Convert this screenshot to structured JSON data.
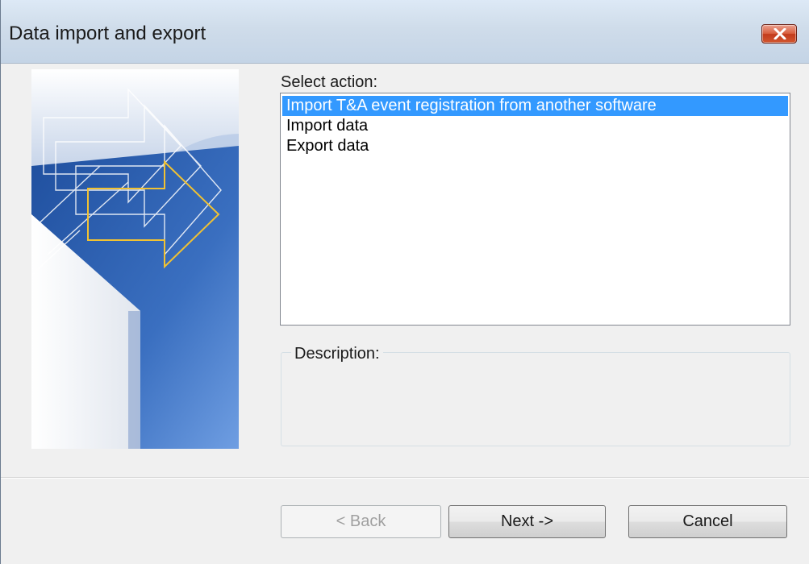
{
  "window": {
    "title": "Data import and export",
    "close_icon": "close-x-icon"
  },
  "action_select": {
    "label": "Select action:",
    "items": [
      "Import T&A event registration from another software",
      "Import data",
      "Export data"
    ],
    "selected_index": 0
  },
  "description": {
    "label": "Description:",
    "text": ""
  },
  "buttons": {
    "back": "< Back",
    "next": "Next ->",
    "cancel": "Cancel"
  },
  "colors": {
    "selection": "#3399ff",
    "banner_arrow_outline": "#f1c232",
    "close_button": "#c84a2c"
  }
}
